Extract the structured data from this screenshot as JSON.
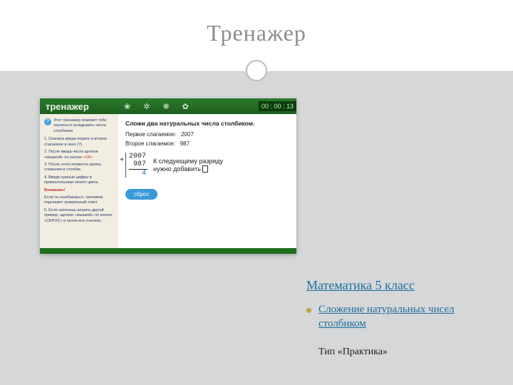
{
  "slide": {
    "title": "Тренажер"
  },
  "trainer": {
    "brand": "тренажер",
    "timer": "00 : 00 : 13",
    "side": {
      "intro": "Этот тренажер поможет тебе научиться складывать числа столбиком.",
      "step1": "1. Сначала введи первое и второе слагаемое в окно (?).",
      "step2_a": "2. После ввода числа щелкни «мышкой» по кнопке ",
      "step2_ok": "«ОК»",
      "step2_b": ".",
      "step3": "3. После этого появится запись сложения в столбик.",
      "step4": "4. Введи нужные цифры в прямоугольники синего цвета.",
      "warn": "Внимание!",
      "warn_text": "Если ты ошибаешься, тренажер подскажет правильный ответ.",
      "step5": "5. Если захочешь решить другой пример, щелкни «мышкой» по кнопке «СБРОС» и начни все сначала."
    },
    "main": {
      "task": "Сложи два натуральных числа столбиком.",
      "first_label": "Первое слагаемое:",
      "first_value": "2007",
      "second_label": "Второе слагаемое:",
      "second_value": "987",
      "calc_n1": "2007",
      "calc_n2": "987",
      "calc_res": "4",
      "hint_line1": "К следующему разряду",
      "hint_line2": "нужно добавить",
      "ok": "сброс"
    }
  },
  "links": {
    "main": "Математика 5 класс",
    "sub": "Сложение натуральных чисел столбиком",
    "type": "Тип «Практика»"
  }
}
